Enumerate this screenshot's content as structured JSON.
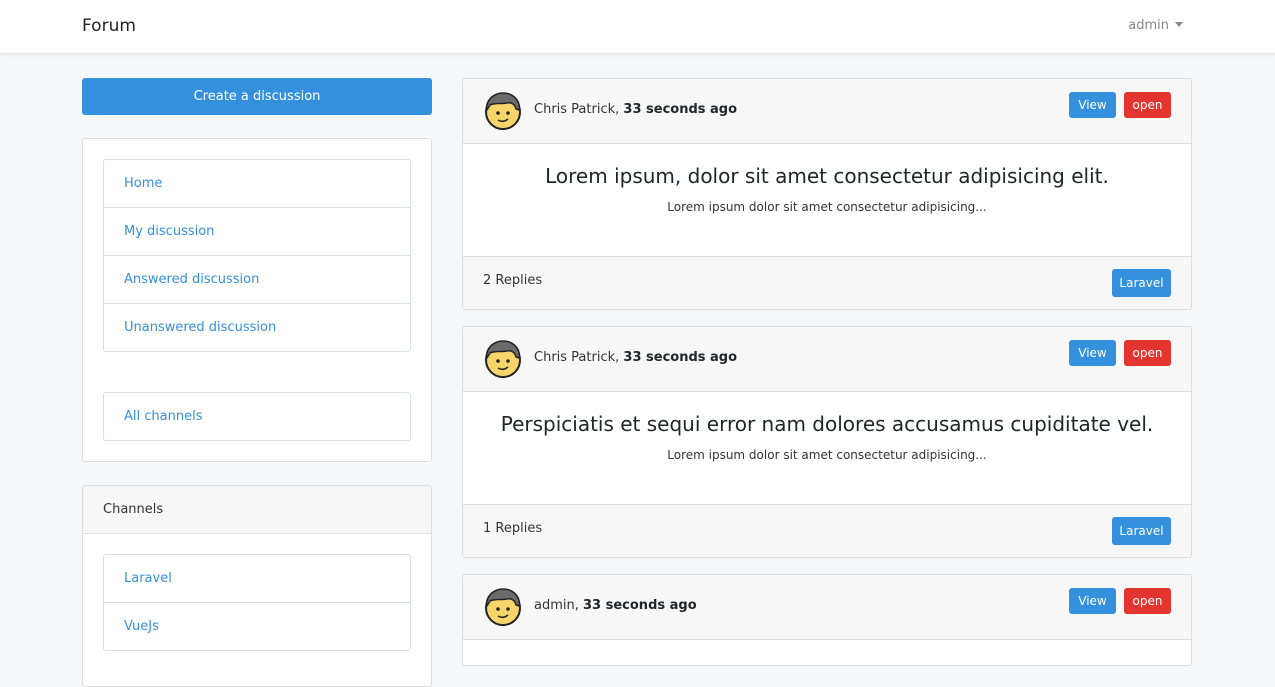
{
  "navbar": {
    "brand": "Forum",
    "user": "admin"
  },
  "sidebar": {
    "create_label": "Create a discussion",
    "nav_items": [
      {
        "label": "Home"
      },
      {
        "label": "My discussion"
      },
      {
        "label": "Answered discussion"
      },
      {
        "label": "Unanswered discussion"
      }
    ],
    "all_channels": "All channels",
    "channels_title": "Channels",
    "channels": [
      {
        "label": "Laravel"
      },
      {
        "label": "VueJs"
      }
    ]
  },
  "discussions": [
    {
      "author": "Chris Patrick",
      "time": "33 seconds ago",
      "title": "Lorem ipsum, dolor sit amet consectetur adipisicing elit.",
      "excerpt": "Lorem ipsum dolor sit amet consectetur adipisicing...",
      "replies": "2 Replies",
      "channel": "Laravel",
      "view_label": "View",
      "open_label": "open"
    },
    {
      "author": "Chris Patrick",
      "time": "33 seconds ago",
      "title": "Perspiciatis et sequi error nam dolores accusamus cupiditate vel.",
      "excerpt": "Lorem ipsum dolor sit amet consectetur adipisicing...",
      "replies": "1 Replies",
      "channel": "Laravel",
      "view_label": "View",
      "open_label": "open"
    },
    {
      "author": "admin",
      "time": "33 seconds ago",
      "view_label": "View",
      "open_label": "open"
    }
  ],
  "icons": {
    "avatar": "avatar-face-icon",
    "caret": "caret-down-icon"
  },
  "colors": {
    "primary": "#3490dc",
    "danger": "#e3342f",
    "background": "#f5f8fa"
  }
}
